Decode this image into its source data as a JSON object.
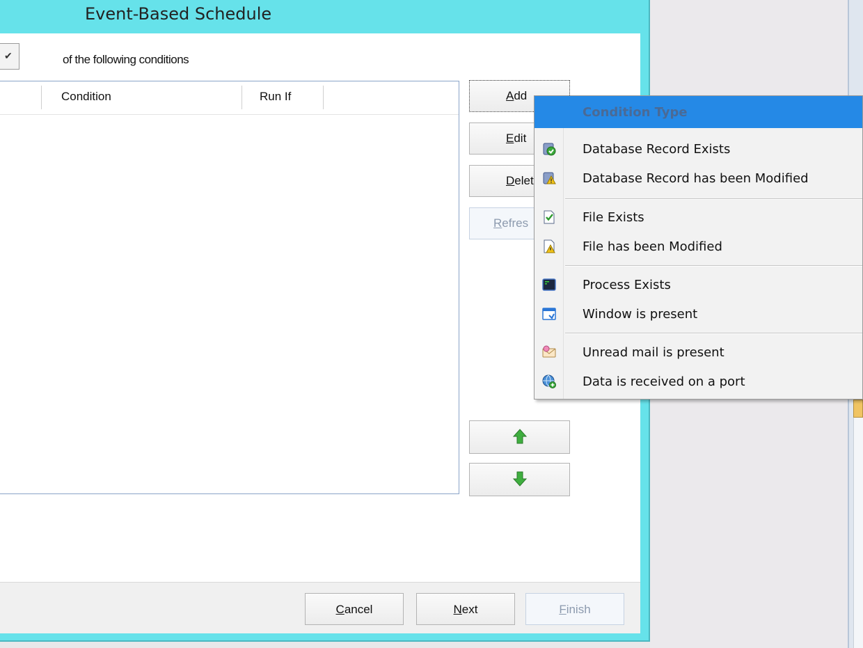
{
  "dialog": {
    "title": "Event-Based Schedule",
    "conditions_label": "of the following conditions",
    "combo_value": "✔"
  },
  "list": {
    "columns": [
      "Condition",
      "Run If"
    ]
  },
  "side_buttons": {
    "add": {
      "pre": "",
      "key": "A",
      "post": "dd"
    },
    "edit": {
      "pre": "",
      "key": "E",
      "post": "dit"
    },
    "delete": {
      "pre": "",
      "key": "D",
      "post": "elet"
    },
    "refresh": {
      "pre": "",
      "key": "R",
      "post": "efres"
    }
  },
  "footer": {
    "cancel": {
      "key": "C",
      "post": "ancel"
    },
    "next": {
      "key": "N",
      "post": "ext"
    },
    "finish": {
      "key": "F",
      "post": "inish"
    }
  },
  "menu": {
    "header": "Condition Type",
    "items": [
      {
        "label": "Database Record Exists",
        "icon": "database-check-icon"
      },
      {
        "label": "Database Record has been Modified",
        "icon": "database-warning-icon"
      },
      {
        "label": "File Exists",
        "icon": "file-check-icon"
      },
      {
        "label": "File has been Modified",
        "icon": "file-warning-icon"
      },
      {
        "label": "Process Exists",
        "icon": "process-terminal-icon"
      },
      {
        "label": "Window is present",
        "icon": "window-icon"
      },
      {
        "label": "Unread mail is present",
        "icon": "mail-icon"
      },
      {
        "label": "Data is received on a port",
        "icon": "network-globe-icon"
      }
    ]
  },
  "colors": {
    "dialog_border": "#66e2ea",
    "menu_highlight": "#2589e6",
    "arrow_green": "#3fae3f"
  }
}
